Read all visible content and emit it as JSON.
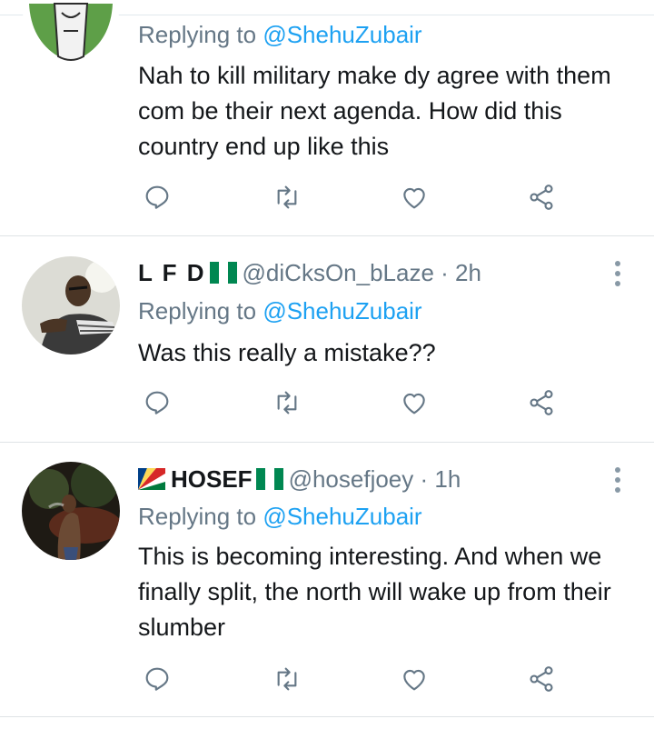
{
  "tweets": [
    {
      "replying_prefix": "Replying to ",
      "mention": "@ShehuZubair",
      "text": "Nah to kill military make dy agree with them com be their next agenda. How did this country end up like this"
    },
    {
      "name": "L F D",
      "handle": "@diCksOn_bLaze",
      "time": "· 2h",
      "replying_prefix": "Replying to ",
      "mention": "@ShehuZubair",
      "text": "Was this really a mistake??"
    },
    {
      "name": "HOSEF",
      "handle": "@hosefjoey",
      "time": "· 1h",
      "replying_prefix": "Replying to ",
      "mention": "@ShehuZubair",
      "text": "This is becoming interesting. And when we finally split, the north will wake up from their slumber"
    }
  ],
  "icons": [
    "reply-icon",
    "retweet-icon",
    "like-icon",
    "share-icon",
    "more-icon"
  ],
  "colors": {
    "accent": "#1da1f2",
    "muted": "#657786",
    "text": "#14171a",
    "icon": "#657786"
  }
}
